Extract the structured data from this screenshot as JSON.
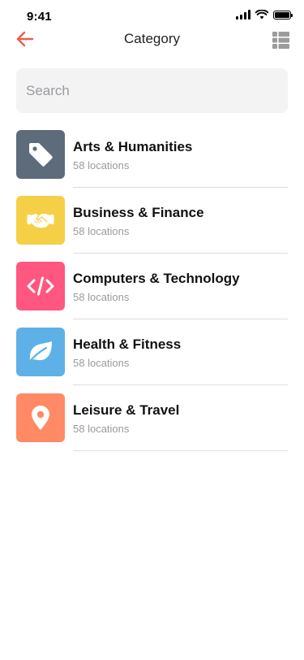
{
  "status_bar": {
    "time": "9:41"
  },
  "header": {
    "title": "Category"
  },
  "search": {
    "placeholder": "Search",
    "value": ""
  },
  "colors": {
    "accent": "#e8604c",
    "icon_gray": "#9b9b9b"
  },
  "categories": [
    {
      "title": "Arts & Humanities",
      "subtitle": "58 locations",
      "icon": "tag-icon",
      "color": "#5d6b7a"
    },
    {
      "title": "Business & Finance",
      "subtitle": "58 locations",
      "icon": "handshake-icon",
      "color": "#f5d046"
    },
    {
      "title": "Computers & Technology",
      "subtitle": "58 locations",
      "icon": "code-icon",
      "color": "#ff5780"
    },
    {
      "title": "Health & Fitness",
      "subtitle": "58 locations",
      "icon": "leaf-icon",
      "color": "#5eb1e6"
    },
    {
      "title": "Leisure & Travel",
      "subtitle": "58 locations",
      "icon": "map-pin-icon",
      "color": "#ff8a65"
    }
  ]
}
